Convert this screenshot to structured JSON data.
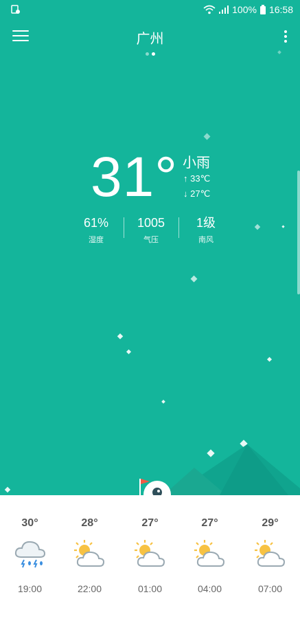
{
  "status_bar": {
    "battery": "100%",
    "time": "16:58"
  },
  "header": {
    "city": "广州"
  },
  "current": {
    "temperature": "31°",
    "condition": "小雨",
    "high": "33℃",
    "low": "27℃",
    "metrics": [
      {
        "value": "61%",
        "label": "湿度"
      },
      {
        "value": "1005",
        "label": "气压"
      },
      {
        "value": "1级",
        "label": "南风"
      }
    ]
  },
  "forecast": [
    {
      "temp": "30°",
      "hour": "19:00",
      "icon": "thunder-rain-cloud-icon"
    },
    {
      "temp": "28°",
      "hour": "22:00",
      "icon": "partly-cloudy-icon"
    },
    {
      "temp": "27°",
      "hour": "01:00",
      "icon": "partly-cloudy-icon"
    },
    {
      "temp": "27°",
      "hour": "04:00",
      "icon": "partly-cloudy-icon"
    },
    {
      "temp": "29°",
      "hour": "07:00",
      "icon": "partly-cloudy-icon"
    }
  ],
  "colors": {
    "background": "#14b59b",
    "mountain_dark": "#0f9a86",
    "mountain_light": "#18a58f"
  }
}
